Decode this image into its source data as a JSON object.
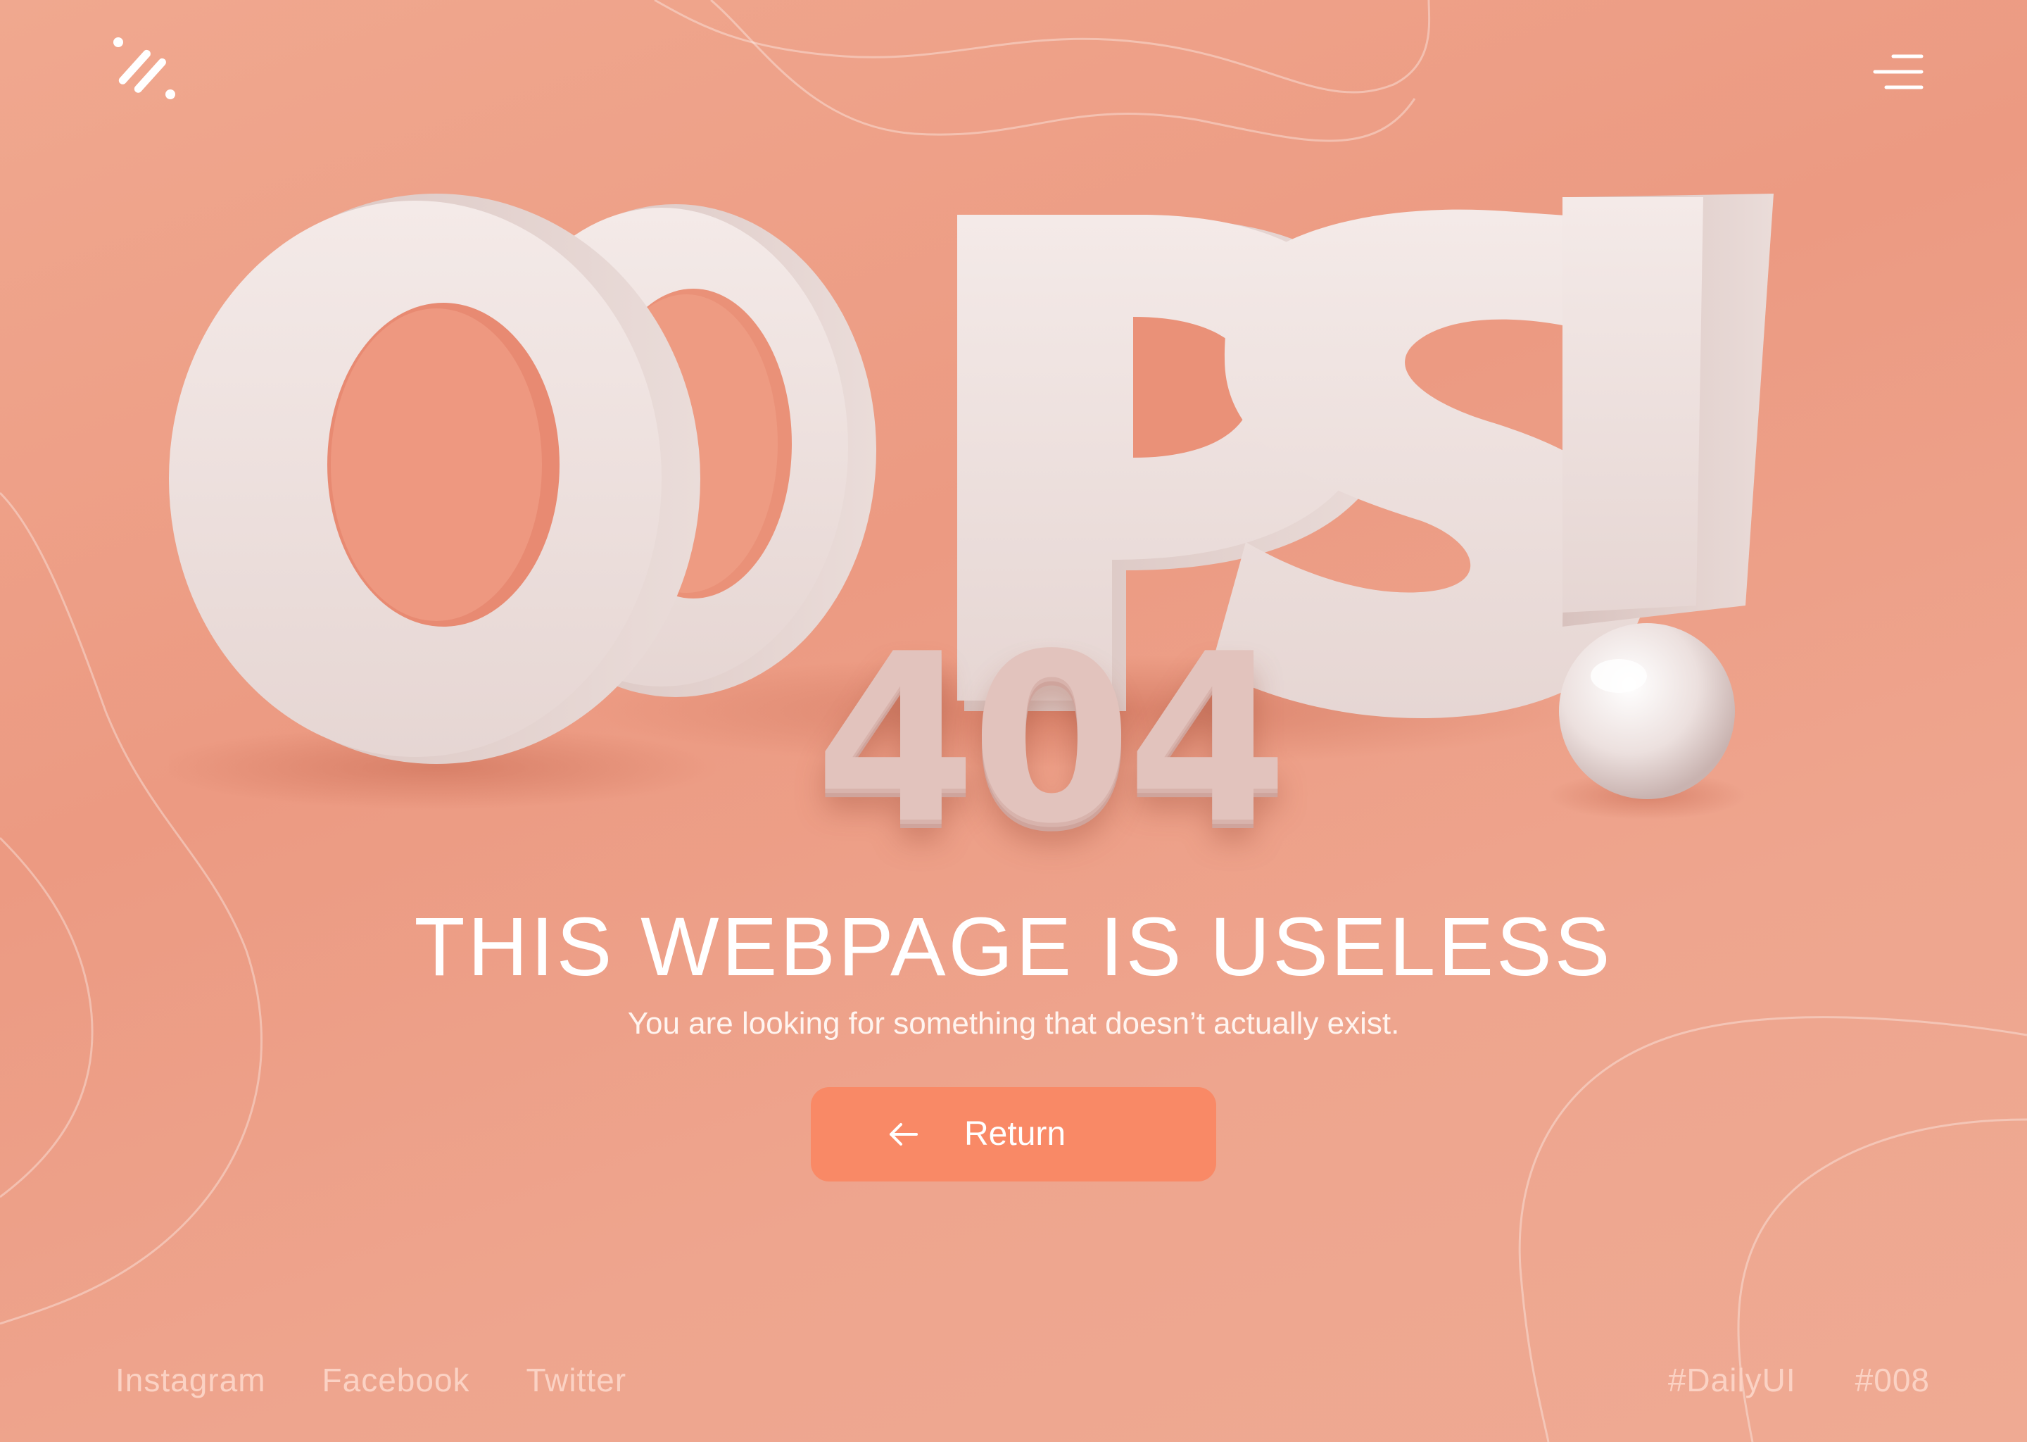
{
  "page": {
    "background_top": "#f0a88f",
    "background_bottom": "#efaa93",
    "accent": "#f98966"
  },
  "header": {
    "logo_icon": "percent-slash-logo-icon",
    "menu_icon": "hamburger-menu-icon"
  },
  "hero": {
    "art_text": "OOPS!",
    "code": "404",
    "title": "THIS WEBPAGE IS USELESS",
    "subtitle": "You are looking for something that doesn’t actually exist."
  },
  "return_button": {
    "label": "Return",
    "icon": "arrow-left-icon"
  },
  "footer": {
    "links": [
      "Instagram",
      "Facebook",
      "Twitter"
    ],
    "tags": [
      "#DailyUI",
      "#008"
    ]
  }
}
